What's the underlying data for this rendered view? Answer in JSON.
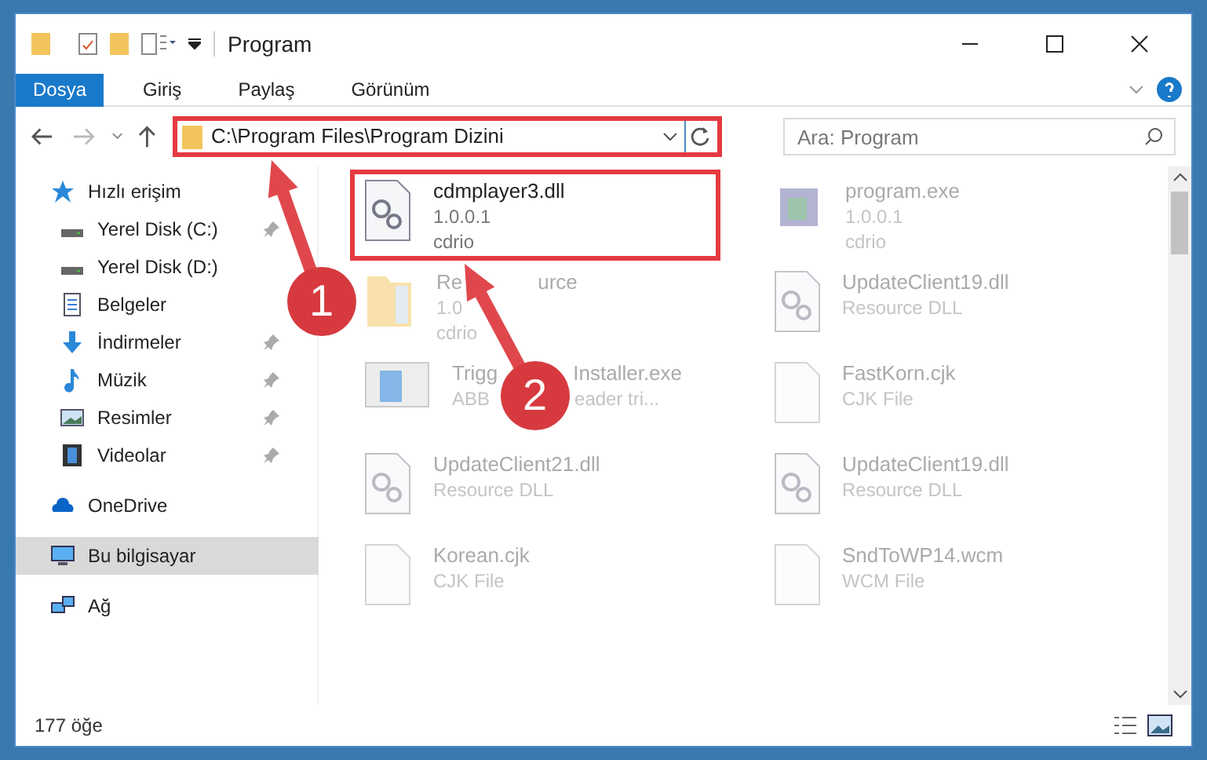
{
  "window": {
    "title": "Program"
  },
  "ribbon_tabs": [
    {
      "label": "Dosya",
      "selected": true
    },
    {
      "label": "Giriş",
      "selected": false
    },
    {
      "label": "Paylaş",
      "selected": false
    },
    {
      "label": "Görünüm",
      "selected": false
    }
  ],
  "address": {
    "path": "C:\\Program Files\\Program Dizini"
  },
  "search": {
    "placeholder": "Ara: Program"
  },
  "sidebar": {
    "items": [
      {
        "label": "Hızlı erişim",
        "kind": "star",
        "pinned": false,
        "selected": false,
        "children": [
          {
            "label": "Yerel Disk (C:)",
            "kind": "disk",
            "pinned": true,
            "selected": false
          },
          {
            "label": "Yerel Disk (D:)",
            "kind": "disk",
            "pinned": false,
            "selected": false
          },
          {
            "label": "Belgeler",
            "kind": "doc",
            "pinned": false,
            "selected": false
          },
          {
            "label": "İndirmeler",
            "kind": "download",
            "pinned": true,
            "selected": false
          },
          {
            "label": "Müzik",
            "kind": "music",
            "pinned": true,
            "selected": false
          },
          {
            "label": "Resimler",
            "kind": "image",
            "pinned": true,
            "selected": false
          },
          {
            "label": "Videolar",
            "kind": "video",
            "pinned": true,
            "selected": false
          }
        ]
      },
      {
        "label": "OneDrive",
        "kind": "cloud",
        "pinned": false,
        "selected": false
      },
      {
        "label": "Bu bilgisayar",
        "kind": "pc",
        "pinned": false,
        "selected": true
      },
      {
        "label": "Ağ",
        "kind": "network",
        "pinned": false,
        "selected": false
      }
    ]
  },
  "files": [
    {
      "name": "cdmplayer3.dll",
      "line_2": "1.0.0.1",
      "line_3": "cdrio",
      "kind": "dll",
      "highlighted": true
    },
    {
      "name": "program.exe",
      "line_2": "1.0.0.1",
      "line_3": "cdrio",
      "kind": "exe",
      "highlighted": false
    },
    {
      "name": "Re",
      "name_tail": "urce",
      "line_2": "1.0",
      "line_3": "cdrio",
      "kind": "folder",
      "highlighted": false
    },
    {
      "name": "UpdateClient19.dll",
      "line_2": "Resource DLL",
      "kind": "dll",
      "highlighted": false
    },
    {
      "name": "Trigg",
      "name_tail": "Installer.exe",
      "line_2": "ABB",
      "line_2_tail": "eader tri...",
      "kind": "installer",
      "highlighted": false
    },
    {
      "name": "FastKorn.cjk",
      "line_2": "CJK File",
      "kind": "blank",
      "highlighted": false
    },
    {
      "name": "UpdateClient21.dll",
      "line_2": "Resource DLL",
      "kind": "dll",
      "highlighted": false
    },
    {
      "name": "UpdateClient19.dll",
      "line_2": "Resource DLL",
      "kind": "dll",
      "highlighted": false
    },
    {
      "name": "Korean.cjk",
      "line_2": "CJK File",
      "kind": "blank",
      "highlighted": false
    },
    {
      "name": "SndToWP14.wcm",
      "line_2": "WCM File",
      "kind": "blank",
      "highlighted": false
    }
  ],
  "callouts": [
    {
      "number": "1"
    },
    {
      "number": "2"
    }
  ],
  "status_bar": {
    "count": "177 öğe"
  }
}
